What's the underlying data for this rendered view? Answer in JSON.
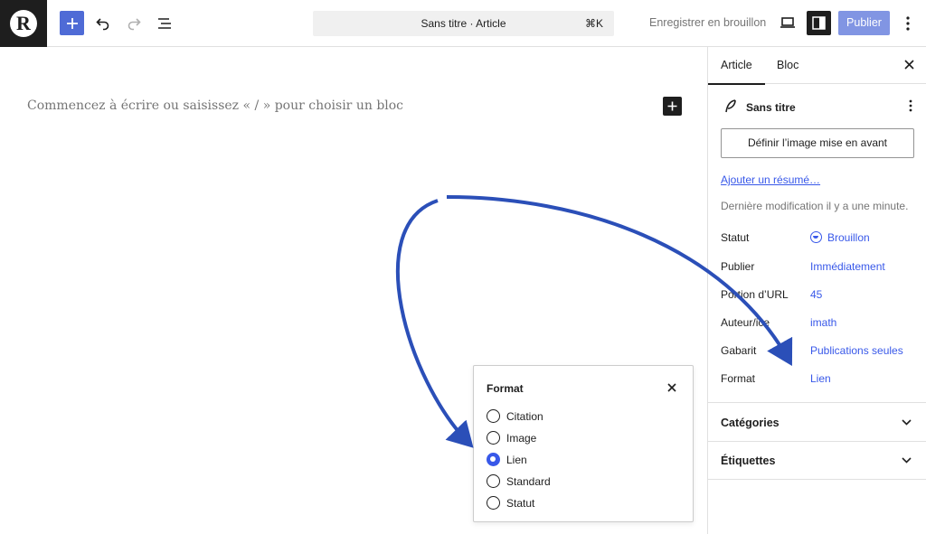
{
  "toolbar": {
    "logo_letter": "R",
    "doc_title": "Sans titre · Article",
    "shortcut": "⌘K",
    "save_draft": "Enregistrer en brouillon",
    "publish": "Publier",
    "icons": [
      "plus-icon",
      "undo-icon",
      "redo-icon",
      "list-view-icon",
      "laptop-icon",
      "sidebar-icon",
      "more-vertical-icon"
    ]
  },
  "editor": {
    "placeholder": "Commencez à écrire ou saisissez « / » pour choisir un bloc"
  },
  "sidebar": {
    "tabs": [
      "Article",
      "Bloc"
    ],
    "post_title": "Sans titre",
    "featured_image_button": "Définir l’image mise en avant",
    "excerpt_link": "Ajouter un résumé…",
    "last_modified": "Dernière modification il y a une minute.",
    "rows": [
      {
        "label": "Statut",
        "value": "Brouillon"
      },
      {
        "label": "Publier",
        "value": "Immédiatement"
      },
      {
        "label": "Portion d’URL",
        "value": "45"
      },
      {
        "label": "Auteur/ice",
        "value": "imath"
      },
      {
        "label": "Gabarit",
        "value": "Publications seules"
      },
      {
        "label": "Format",
        "value": "Lien"
      }
    ],
    "panels": [
      "Catégories",
      "Étiquettes"
    ]
  },
  "format_popover": {
    "title": "Format",
    "options": [
      "Citation",
      "Image",
      "Lien",
      "Standard",
      "Statut"
    ],
    "selected": "Lien"
  },
  "colors": {
    "accent": "#3858e9",
    "arrow": "#2b4fb8",
    "publish_bg": "#8195e3",
    "dark": "#1e1e1e"
  }
}
